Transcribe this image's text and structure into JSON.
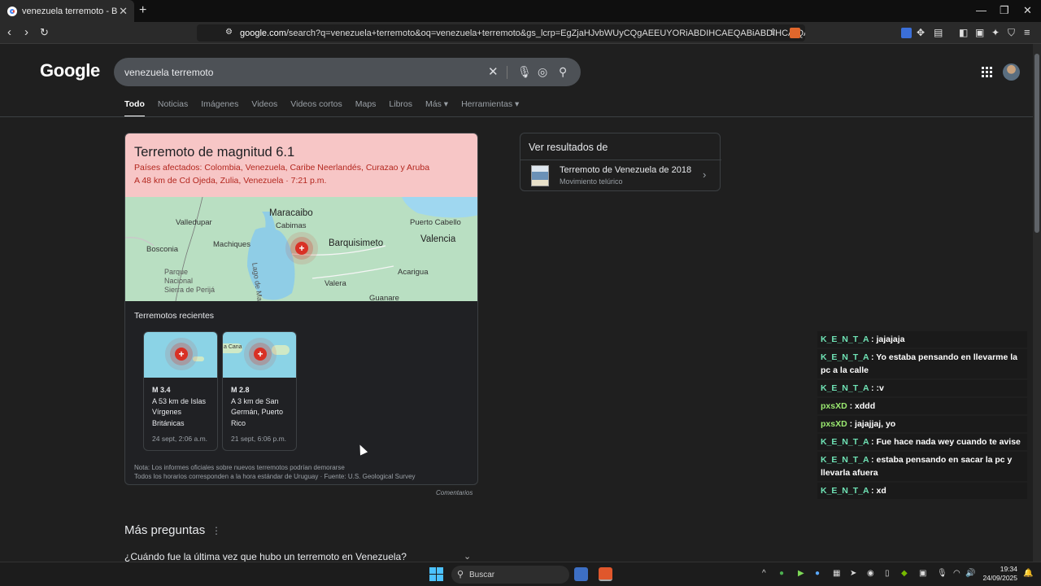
{
  "browser": {
    "tab_title": "venezuela terremoto - Buscar con",
    "url_domain": "google.com",
    "url_rest": "/search?q=venezuela+terremoto&oq=venezuela+terremoto&gs_lcrp=EgZjaHJvbWUyCQgAEEUYORiABDIHCAEQABiABDIHCAIQABiABDIHCAM..."
  },
  "google": {
    "logo": "Google",
    "query": "venezuela terremoto",
    "tabs": [
      "Todo",
      "Noticias",
      "Imágenes",
      "Videos",
      "Videos cortos",
      "Maps",
      "Libros",
      "Más ▾",
      "Herramientas ▾"
    ]
  },
  "quake": {
    "title": "Terremoto de magnitud 6.1",
    "countries": "Países afectados: Colombia, Venezuela, Caribe Neerlandés, Curazao y Aruba",
    "location": "A 48 km de Cd Ojeda, Zulia, Venezuela · 7:21 p.m.",
    "map_labels": {
      "valledupar": "Valledupar",
      "maracaibo": "Maracaibo",
      "cabimas": "Cabimas",
      "puerto_cabello": "Puerto Cabello",
      "bosconia": "Bosconia",
      "machiques": "Machiques",
      "lago": "Lago de Maracaibo",
      "barquisimeto": "Barquisimeto",
      "valencia": "Valencia",
      "acarigua": "Acarigua",
      "parque": "Parque\nNacional\nSierra de Perijá",
      "valera": "Valera",
      "guanare": "Guanare"
    },
    "recent_heading": "Terremotos recientes",
    "recent": [
      {
        "mag": "M 3.4",
        "desc": "A 53 km de Islas Vírgenes Británicas",
        "date": "24 sept, 2:06 a.m."
      },
      {
        "mag": "M 2.8",
        "desc": "A 3 km de San Germán, Puerto Rico",
        "date": "21 sept, 6:06 p.m.",
        "map_label": "a Cana"
      }
    ],
    "note1": "Nota: Los informes oficiales sobre nuevos terremotos podrían demorarse",
    "note2": "Todos los horarios corresponden a la hora estándar de Uruguay · Fuente: U.S. Geological Survey",
    "comments": "Comentarios"
  },
  "see_results": {
    "title": "Ver resultados de",
    "item": "Terremoto de Venezuela de 2018",
    "sub": "Movimiento telúrico"
  },
  "more_questions": {
    "heading": "Más preguntas",
    "q1": "¿Cuándo fue la última vez que hubo un terremoto en Venezuela?"
  },
  "chat": [
    {
      "user": "K_E_N_T_A",
      "msg": "jajajaja",
      "color": "#6fe3b5"
    },
    {
      "user": "K_E_N_T_A",
      "msg": "Yo estaba pensando en llevarme la pc a la calle",
      "color": "#6fe3b5"
    },
    {
      "user": "K_E_N_T_A",
      "msg": ":v",
      "color": "#6fe3b5"
    },
    {
      "user": "pxsXD",
      "msg": "xddd",
      "color": "#9bea71"
    },
    {
      "user": "pxsXD",
      "msg": "jajajjaj, yo",
      "color": "#9bea71"
    },
    {
      "user": "K_E_N_T_A",
      "msg": "Fue hace nada wey cuando te avise",
      "color": "#6fe3b5"
    },
    {
      "user": "K_E_N_T_A",
      "msg": "estaba pensando en sacar la pc y llevarla afuera",
      "color": "#6fe3b5"
    },
    {
      "user": "K_E_N_T_A",
      "msg": "xd",
      "color": "#6fe3b5"
    }
  ],
  "taskbar": {
    "search": "Buscar",
    "time": "19:34",
    "date": "24/09/2025"
  },
  "colors": {
    "quake_header": "#f7c6c6",
    "quake_text": "#b3261e",
    "pin": "#d93025",
    "background": "#1f1f1f"
  }
}
